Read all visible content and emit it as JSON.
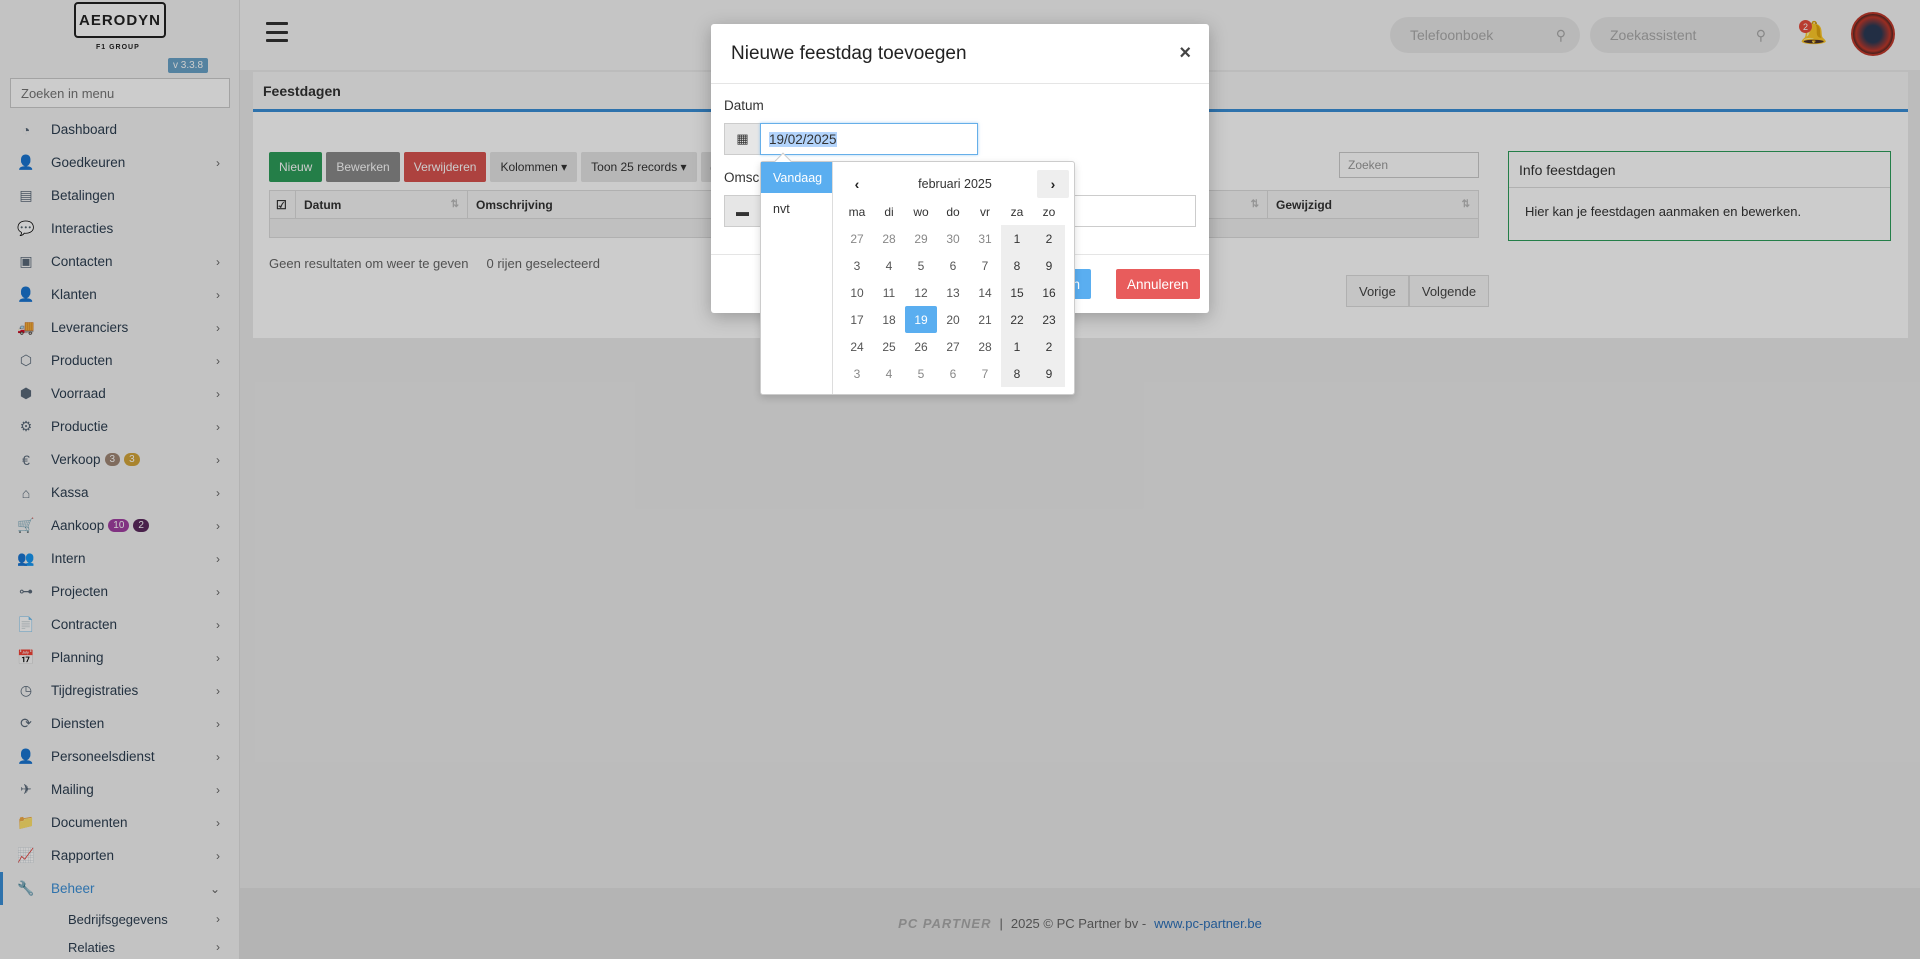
{
  "app": {
    "brand": "AERODYN",
    "brand_sub": "F1 GROUP",
    "version": "v 3.3.8"
  },
  "sidebar": {
    "search_placeholder": "Zoeken in menu",
    "items": [
      {
        "label": "Dashboard",
        "icon": "dashboard-icon",
        "glyph": "◔",
        "chevron": false
      },
      {
        "label": "Goedkeuren",
        "icon": "user-check-icon",
        "glyph": "👤",
        "chevron": true
      },
      {
        "label": "Betalingen",
        "icon": "payment-icon",
        "glyph": "▤",
        "chevron": false
      },
      {
        "label": "Interacties",
        "icon": "chat-icon",
        "glyph": "💬",
        "chevron": false
      },
      {
        "label": "Contacten",
        "icon": "contact-card-icon",
        "glyph": "▣",
        "chevron": true
      },
      {
        "label": "Klanten",
        "icon": "user-icon",
        "glyph": "👤",
        "chevron": true
      },
      {
        "label": "Leveranciers",
        "icon": "truck-icon",
        "glyph": "🚚",
        "chevron": true
      },
      {
        "label": "Producten",
        "icon": "box-icon",
        "glyph": "⬡",
        "chevron": true
      },
      {
        "label": "Voorraad",
        "icon": "boxes-icon",
        "glyph": "⬢",
        "chevron": true
      },
      {
        "label": "Productie",
        "icon": "gears-icon",
        "glyph": "⚙",
        "chevron": true
      },
      {
        "label": "Verkoop",
        "icon": "euro-icon",
        "glyph": "€",
        "chevron": true,
        "badges": [
          {
            "text": "3",
            "color": "#a08876"
          },
          {
            "text": "3",
            "color": "#d4a53a"
          }
        ]
      },
      {
        "label": "Kassa",
        "icon": "basket-icon",
        "glyph": "⌂",
        "chevron": true
      },
      {
        "label": "Aankoop",
        "icon": "cart-icon",
        "glyph": "🛒",
        "chevron": true,
        "badges": [
          {
            "text": "10",
            "color": "#a23fa3"
          },
          {
            "text": "2",
            "color": "#5c2a5e"
          }
        ]
      },
      {
        "label": "Intern",
        "icon": "users-icon",
        "glyph": "👥",
        "chevron": true
      },
      {
        "label": "Projecten",
        "icon": "project-icon",
        "glyph": "⊶",
        "chevron": true
      },
      {
        "label": "Contracten",
        "icon": "contract-icon",
        "glyph": "📄",
        "chevron": true
      },
      {
        "label": "Planning",
        "icon": "calendar-icon",
        "glyph": "📅",
        "chevron": true
      },
      {
        "label": "Tijdregistraties",
        "icon": "timer-icon",
        "glyph": "◷",
        "chevron": true
      },
      {
        "label": "Diensten",
        "icon": "refresh-icon",
        "glyph": "⟳",
        "chevron": true
      },
      {
        "label": "Personeelsdienst",
        "icon": "person-badge-icon",
        "glyph": "👤",
        "chevron": true
      },
      {
        "label": "Mailing",
        "icon": "paper-plane-icon",
        "glyph": "✈",
        "chevron": true
      },
      {
        "label": "Documenten",
        "icon": "folder-icon",
        "glyph": "📁",
        "chevron": true
      },
      {
        "label": "Rapporten",
        "icon": "chart-line-icon",
        "glyph": "📈",
        "chevron": true
      }
    ],
    "active_item": {
      "label": "Beheer",
      "icon": "wrench-icon",
      "glyph": "🔧"
    },
    "subitems": [
      {
        "label": "Bedrijfsgegevens"
      },
      {
        "label": "Relaties"
      }
    ]
  },
  "topbar": {
    "phonebook_placeholder": "Telefoonboek",
    "assistant_placeholder": "Zoekassistent",
    "notification_count": "2"
  },
  "page": {
    "title": "Feestdagen",
    "toolbar": {
      "new": "Nieuw",
      "edit": "Bewerken",
      "delete": "Verwijderen",
      "columns": "Kolommen ▾",
      "show": "Toon 25 records ▾"
    },
    "table_search_placeholder": "Zoeken",
    "columns": [
      "Datum",
      "Omschrijving",
      "Gewijzigd"
    ],
    "no_results": "Geen resultaten om weer te geven",
    "selected": "0 rijen geselecteerd",
    "prev": "Vorige",
    "next": "Volgende",
    "info_title": "Info feestdagen",
    "info_body": "Hier kan je feestdagen aanmaken en bewerken."
  },
  "footer": {
    "logo": "PC PARTNER",
    "separator": "|",
    "copyright": "2025 © PC Partner bv -",
    "link": "www.pc-partner.be"
  },
  "modal": {
    "title": "Nieuwe feestdag toevoegen",
    "close": "×",
    "date_label": "Datum",
    "date_value": "19/02/2025",
    "desc_label": "Omschrijving",
    "save": "Toevoegen",
    "cancel": "Annuleren"
  },
  "datepicker": {
    "ranges": [
      "Vandaag",
      "nvt"
    ],
    "month": "februari 2025",
    "dow": [
      "ma",
      "di",
      "wo",
      "do",
      "vr",
      "za",
      "zo"
    ],
    "weeks": [
      [
        "27",
        "28",
        "29",
        "30",
        "31",
        "1",
        "2"
      ],
      [
        "3",
        "4",
        "5",
        "6",
        "7",
        "8",
        "9"
      ],
      [
        "10",
        "11",
        "12",
        "13",
        "14",
        "15",
        "16"
      ],
      [
        "17",
        "18",
        "19",
        "20",
        "21",
        "22",
        "23"
      ],
      [
        "24",
        "25",
        "26",
        "27",
        "28",
        "1",
        "2"
      ],
      [
        "3",
        "4",
        "5",
        "6",
        "7",
        "8",
        "9"
      ]
    ],
    "other_month": [
      [
        0,
        0
      ],
      [
        0,
        1
      ],
      [
        0,
        2
      ],
      [
        0,
        3
      ],
      [
        0,
        4
      ],
      [
        4,
        5
      ],
      [
        4,
        6
      ],
      [
        5,
        0
      ],
      [
        5,
        1
      ],
      [
        5,
        2
      ],
      [
        5,
        3
      ],
      [
        5,
        4
      ],
      [
        5,
        5
      ],
      [
        5,
        6
      ]
    ],
    "selected": "19"
  },
  "colors": {
    "accent": "#3a8fd8",
    "success": "#2e9e5a",
    "danger": "#d9534f",
    "datepicker_active": "#5aaef0"
  }
}
